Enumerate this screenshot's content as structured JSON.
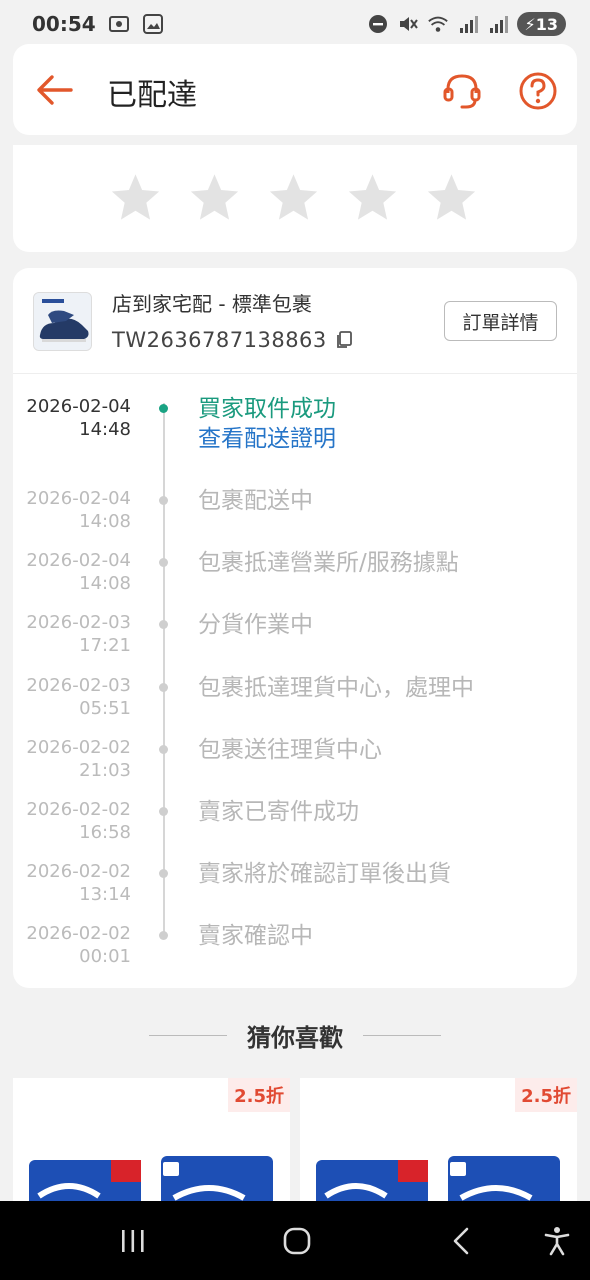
{
  "status_bar": {
    "time": "00:54",
    "battery": "13"
  },
  "header": {
    "title": "已配達"
  },
  "rating": {
    "stars": 5,
    "filled": 0
  },
  "shipment": {
    "method": "店到家宅配 - 標準包裹",
    "tracking_number": "TW2636787138863",
    "order_details_label": "訂單詳情",
    "events": [
      {
        "date": "2026-02-04",
        "time": "14:48",
        "text": "買家取件成功",
        "link": "查看配送證明"
      },
      {
        "date": "2026-02-04",
        "time": "14:08",
        "text": "包裹配送中"
      },
      {
        "date": "2026-02-04",
        "time": "14:08",
        "text": "包裹抵達營業所/服務據點"
      },
      {
        "date": "2026-02-03",
        "time": "17:21",
        "text": "分貨作業中"
      },
      {
        "date": "2026-02-03",
        "time": "05:51",
        "text": "包裹抵達理貨中心，處理中"
      },
      {
        "date": "2026-02-02",
        "time": "21:03",
        "text": "包裹送往理貨中心"
      },
      {
        "date": "2026-02-02",
        "time": "16:58",
        "text": "賣家已寄件成功"
      },
      {
        "date": "2026-02-02",
        "time": "13:14",
        "text": "賣家將於確認訂單後出貨"
      },
      {
        "date": "2026-02-02",
        "time": "00:01",
        "text": "賣家確認中"
      }
    ]
  },
  "recommendations": {
    "title": "猜你喜歡",
    "products": [
      {
        "discount": "2.5折"
      },
      {
        "discount": "2.5折"
      }
    ]
  },
  "colors": {
    "accent": "#e2572b",
    "success": "#1a9a7e",
    "link": "#2675c8"
  }
}
